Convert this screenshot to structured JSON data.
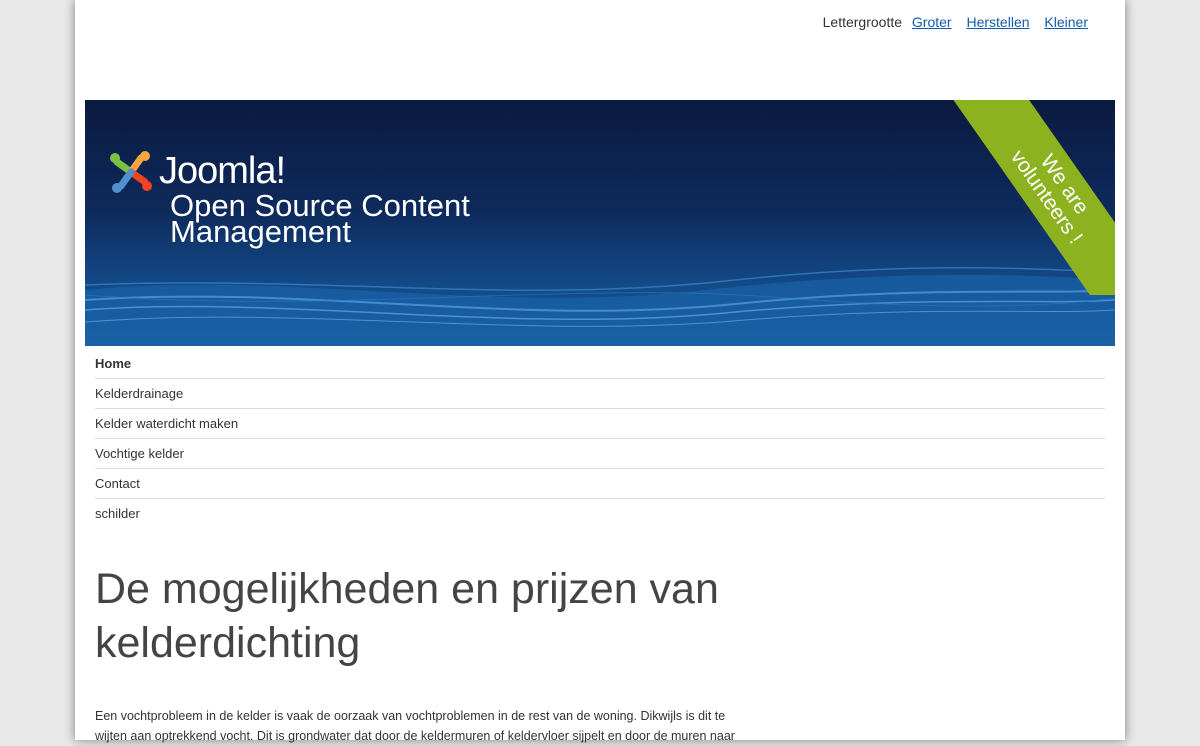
{
  "fontsize": {
    "label": "Lettergrootte",
    "bigger": "Groter",
    "reset": "Herstellen",
    "smaller": "Kleiner"
  },
  "header": {
    "brand": "Joomla!",
    "tagline": "Open Source Content Management",
    "ribbon_line1": "We are",
    "ribbon_line2": "volunteers !"
  },
  "menu": {
    "items": [
      {
        "label": "Home"
      },
      {
        "label": "Kelderdrainage"
      },
      {
        "label": "Kelder waterdicht maken"
      },
      {
        "label": "Vochtige kelder"
      },
      {
        "label": "Contact"
      },
      {
        "label": "schilder"
      }
    ]
  },
  "article": {
    "title": "De mogelijkheden en prijzen van kelderdichting",
    "body": "Een vochtprobleem in de kelder is vaak de oorzaak van vochtproblemen in de rest van de woning. Dikwijls is dit te wijten aan optrekkend vocht. Dit is grondwater dat door de keldermuren of keldervloer sijpelt en door de muren naar"
  },
  "colors": {
    "link": "#135cae",
    "header_dark": "#0b1a40",
    "ribbon": "#8cb31f"
  }
}
